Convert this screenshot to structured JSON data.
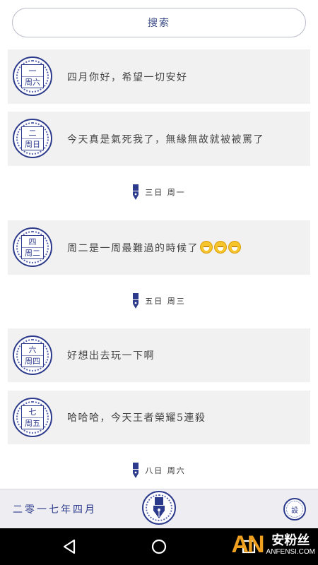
{
  "search": {
    "label": "搜索"
  },
  "entries": [
    {
      "stamp_day": "一",
      "stamp_weekday": "周六",
      "text": "四月你好，希望一切安好"
    },
    {
      "stamp_day": "二",
      "stamp_weekday": "周日",
      "text": "今天真是氣死我了，無緣無故就被被罵了"
    },
    {
      "stamp_day": "四",
      "stamp_weekday": "周二",
      "text": "周二是一周最難過的時候了"
    },
    {
      "stamp_day": "六",
      "stamp_weekday": "周四",
      "text": "好想出去玩一下啊"
    },
    {
      "stamp_day": "七",
      "stamp_weekday": "周五",
      "text": "哈哈哈，今天王者榮耀5連殺"
    }
  ],
  "dividers": [
    {
      "label": "三日 周一"
    },
    {
      "label": "五日 周三"
    },
    {
      "label": "八日 周六"
    }
  ],
  "bottom_bar": {
    "month": "二零一七年四月",
    "right_icon_label": "設"
  },
  "watermark": {
    "logo": "AN",
    "cn": "安粉丝",
    "en": "ANFENSI.COM"
  },
  "icons": {
    "search": "none",
    "divider": "fountain-pen-nib-icon",
    "center": "fountain-pen-icon",
    "nav": [
      "back-triangle-icon",
      "home-circle-icon",
      "recents-square-icon"
    ]
  },
  "colors": {
    "accent": "#2c3a8c",
    "card": "#f1f1f1",
    "bottom_bar": "#eeeef2"
  }
}
